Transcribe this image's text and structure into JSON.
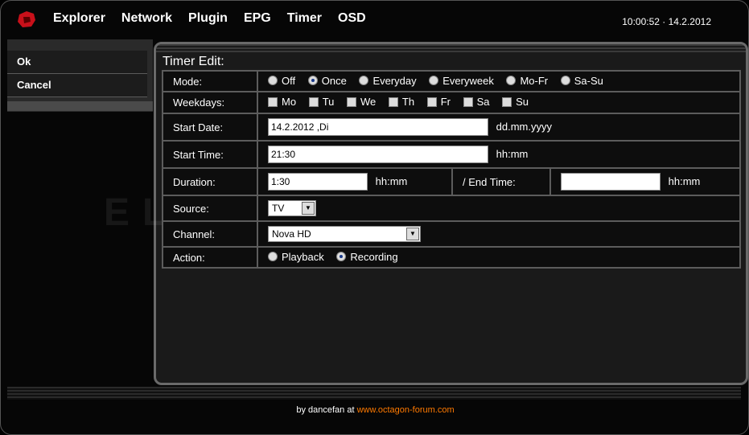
{
  "nav": [
    "Explorer",
    "Network",
    "Plugin",
    "EPG",
    "Timer",
    "OSD"
  ],
  "clock": "10:00:52 · 14.2.2012",
  "sidebar": {
    "items": [
      "Ok",
      "Cancel"
    ]
  },
  "panel_title": "Timer Edit:",
  "watermark": "ELLANO.SK",
  "form": {
    "mode": {
      "label": "Mode:",
      "options": [
        "Off",
        "Once",
        "Everyday",
        "Everyweek",
        "Mo-Fr",
        "Sa-Su"
      ],
      "selected": "Once"
    },
    "weekdays": {
      "label": "Weekdays:",
      "days": [
        "Mo",
        "Tu",
        "We",
        "Th",
        "Fr",
        "Sa",
        "Su"
      ]
    },
    "start_date": {
      "label": "Start Date:",
      "value": "14.2.2012 ,Di",
      "hint": "dd.mm.yyyy"
    },
    "start_time": {
      "label": "Start Time:",
      "value": "21:30",
      "hint": "hh:mm"
    },
    "duration": {
      "label": "Duration:",
      "value": "1:30",
      "hint": "hh:mm",
      "end_label": "/ End Time:",
      "end_value": "",
      "end_hint": "hh:mm"
    },
    "source": {
      "label": "Source:",
      "value": "TV"
    },
    "channel": {
      "label": "Channel:",
      "value": "Nova HD"
    },
    "action": {
      "label": "Action:",
      "options": [
        "Playback",
        "Recording"
      ],
      "selected": "Recording"
    }
  },
  "footer": {
    "prefix": "by dancefan at",
    "link": "www.octagon-forum.com",
    "link_color": "#ff7a00"
  }
}
